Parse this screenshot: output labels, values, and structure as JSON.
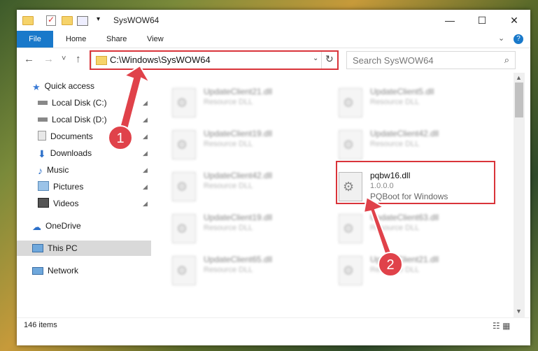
{
  "window": {
    "title": "SysWOW64",
    "minimize": "—",
    "maximize": "☐",
    "close": "✕"
  },
  "ribbon": {
    "file_tab": "File",
    "tabs": [
      "Home",
      "Share",
      "View"
    ],
    "help": "?",
    "expand": "⌄"
  },
  "nav": {
    "back": "←",
    "forward": "→",
    "recent": "˅",
    "up": "↑",
    "address": "C:\\Windows\\SysWOW64",
    "address_dropdown": "⌄",
    "refresh": "↻",
    "search_placeholder": "Search SysWOW64",
    "search_icon": "⌕"
  },
  "sidebar": {
    "quick_access": "Quick access",
    "items": [
      {
        "label": "Local Disk (C:)",
        "icon": "drive-icon"
      },
      {
        "label": "Local Disk (D:)",
        "icon": "drive-icon"
      },
      {
        "label": "Documents",
        "icon": "documents-icon"
      },
      {
        "label": "Downloads",
        "icon": "downloads-icon"
      },
      {
        "label": "Music",
        "icon": "music-icon"
      },
      {
        "label": "Pictures",
        "icon": "pictures-icon"
      },
      {
        "label": "Videos",
        "icon": "videos-icon"
      }
    ],
    "onedrive": "OneDrive",
    "this_pc": "This PC",
    "network": "Network",
    "pin_glyph": "📌"
  },
  "files": [
    {
      "name": "UpdateClient21.dll",
      "desc": "Resource DLL"
    },
    {
      "name": "UpdateClient5.dll",
      "desc": "Resource DLL"
    },
    {
      "name": "UpdateClient19.dll",
      "desc": "Resource DLL"
    },
    {
      "name": "UpdateClient42.dll",
      "desc": "Resource DLL"
    },
    {
      "name": "UpdateClient42.dll",
      "desc": "Resource DLL"
    },
    {
      "name": "pqbw16.dll",
      "desc": "1.0.0.0",
      "sub": "PQBoot for Windows"
    },
    {
      "name": "UpdateClient19.dll",
      "desc": "Resource DLL"
    },
    {
      "name": "UpdateClient63.dll",
      "desc": "Resource DLL"
    },
    {
      "name": "UpdateClient65.dll",
      "desc": "Resource DLL"
    },
    {
      "name": "UpdateClient21.dll",
      "desc": "Resource DLL"
    }
  ],
  "status": {
    "count": "146 items",
    "view_icons": "☷ ▦"
  },
  "annotations": {
    "step1": "1",
    "step2": "2"
  },
  "colors": {
    "accent": "#1979ca",
    "highlight": "#d9343a"
  }
}
